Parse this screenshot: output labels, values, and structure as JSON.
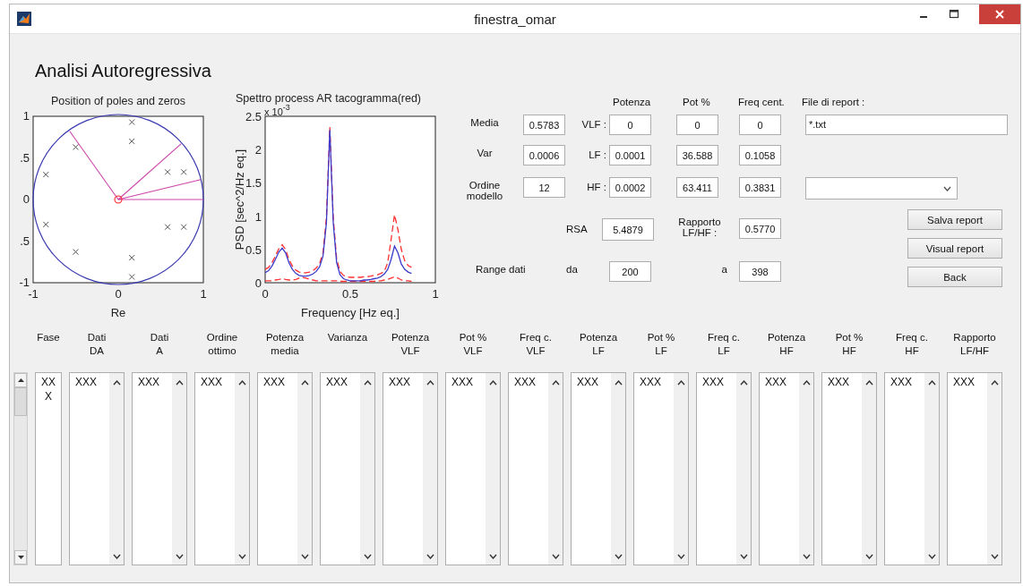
{
  "window": {
    "title": "finestra_omar"
  },
  "heading": "Analisi Autoregressiva",
  "pole_zero_plot": {
    "title": "Position of poles and zeros",
    "chart_data": {
      "type": "scatter",
      "xlabel": "Re",
      "xlim": [
        -1,
        1
      ],
      "ylim": [
        -1,
        1
      ],
      "xticks": [
        -1,
        0,
        1
      ],
      "yticks": [
        {
          "value": 1,
          "label": "1"
        },
        {
          "value": 0.5,
          "label": ".5"
        },
        {
          "value": 0,
          "label": "0"
        },
        {
          "value": -0.5,
          "label": ".5"
        },
        {
          "value": -1,
          "label": "-1"
        }
      ],
      "x": [
        0.16,
        0.16,
        -0.5,
        -0.85,
        0.58,
        0.77,
        0.58,
        0.77,
        -0.85,
        -0.5,
        0.16,
        0.16
      ],
      "series": [
        {
          "color": "#555555",
          "values": [
            0.93,
            0.7,
            0.63,
            0.3,
            0.33,
            0.33,
            -0.33,
            -0.33,
            -0.3,
            -0.63,
            -0.7,
            -0.93
          ]
        }
      ]
    }
  },
  "spectrum_plot": {
    "title": "Spettro process AR tacogramma(red)",
    "exponent": {
      "base": "x 10",
      "power": "-3"
    },
    "chart_data": {
      "type": "line",
      "xlabel": "Frequency [Hz eq.]",
      "ylabel": "PSD [sec^2/Hz eq.]",
      "xlim": [
        0,
        1
      ],
      "ylim": [
        0,
        2.5
      ],
      "xticks": [
        0,
        0.5,
        1
      ],
      "yticks": [
        0,
        0.5,
        1,
        1.5,
        2,
        2.5
      ],
      "x": [
        0,
        0.02,
        0.04,
        0.06,
        0.08,
        0.1,
        0.12,
        0.14,
        0.16,
        0.18,
        0.2,
        0.22,
        0.24,
        0.26,
        0.28,
        0.3,
        0.32,
        0.34,
        0.36,
        0.38,
        0.4,
        0.42,
        0.44,
        0.46,
        0.48,
        0.5,
        0.52,
        0.54,
        0.56,
        0.58,
        0.6,
        0.62,
        0.64,
        0.66,
        0.68,
        0.7,
        0.72,
        0.74,
        0.76,
        0.78,
        0.8,
        0.82,
        0.84,
        0.86
      ],
      "series": [
        {
          "color": "#ff3030",
          "line_style": "dashed",
          "values": [
            0.2,
            0.23,
            0.3,
            0.4,
            0.51,
            0.57,
            0.5,
            0.35,
            0.25,
            0.19,
            0.16,
            0.15,
            0.15,
            0.16,
            0.18,
            0.22,
            0.29,
            0.45,
            0.98,
            2.34,
            0.98,
            0.36,
            0.17,
            0.11,
            0.09,
            0.08,
            0.08,
            0.08,
            0.08,
            0.09,
            0.09,
            0.1,
            0.11,
            0.12,
            0.14,
            0.17,
            0.3,
            0.65,
            1.02,
            0.8,
            0.5,
            0.33,
            0.26,
            0.23
          ]
        },
        {
          "color": "#ff3030",
          "line_style": "dashed",
          "values": [
            0.03,
            0.03,
            0.03,
            0.04,
            0.05,
            0.06,
            0.05,
            0.04,
            0.04,
            0.05,
            0.07,
            0.08,
            0.07,
            0.05,
            0.04,
            0.03,
            0.03,
            0.03,
            0.03,
            0.03,
            0.03,
            0.03,
            0.02,
            0.02,
            0.02,
            0.02,
            0.02,
            0.02,
            0.02,
            0.02,
            0.02,
            0.02,
            0.02,
            0.03,
            0.03,
            0.04,
            0.05,
            0.07,
            0.09,
            0.07,
            0.04,
            0.03,
            0.03,
            0.02
          ]
        },
        {
          "color": "#3a3acc",
          "line_style": "solid",
          "values": [
            0.15,
            0.18,
            0.25,
            0.35,
            0.46,
            0.52,
            0.45,
            0.3,
            0.2,
            0.14,
            0.11,
            0.1,
            0.1,
            0.11,
            0.13,
            0.17,
            0.24,
            0.4,
            0.9,
            2.3,
            0.9,
            0.3,
            0.12,
            0.06,
            0.04,
            0.03,
            0.03,
            0.03,
            0.03,
            0.04,
            0.04,
            0.05,
            0.06,
            0.07,
            0.09,
            0.13,
            0.2,
            0.35,
            0.55,
            0.45,
            0.28,
            0.2,
            0.16,
            0.14
          ]
        }
      ]
    }
  },
  "parameters": {
    "headers": [
      "Potenza",
      "Pot %",
      "Freq cent."
    ],
    "rows": [
      {
        "label": "Media",
        "value": "0.5783",
        "band": "VLF :",
        "potenza": "0",
        "pot_pct": "0",
        "freq_cent": "0"
      },
      {
        "label": "Var",
        "value": "0.0006",
        "band": "LF :",
        "potenza": "0.0001",
        "pot_pct": "36.588",
        "freq_cent": "0.1058"
      },
      {
        "label": "Ordine modello",
        "value": "12",
        "band": "HF :",
        "potenza": "0.0002",
        "pot_pct": "63.411",
        "freq_cent": "0.3831"
      }
    ]
  },
  "report": {
    "label": "File di report :",
    "file_field": "*.txt"
  },
  "rsa": {
    "label": "RSA",
    "value": "5.4879"
  },
  "ratio": {
    "label": "Rapporto LF/HF :",
    "value": "0.5770"
  },
  "range": {
    "label": "Range dati",
    "from_label": "da",
    "from": "200",
    "to_label": "a",
    "to": "398"
  },
  "buttons": [
    "Salva report",
    "Visual report",
    "Back"
  ],
  "results_table": {
    "columns": [
      {
        "header": "Fase",
        "kind": "plain",
        "items": [
          "XXX"
        ]
      },
      {
        "header": "Dati\nDA",
        "kind": "list",
        "items": [
          "XXX"
        ]
      },
      {
        "header": "Dati\nA",
        "kind": "list",
        "items": [
          "XXX"
        ]
      },
      {
        "header": "Ordine\nottimo",
        "kind": "list",
        "items": [
          "XXX"
        ]
      },
      {
        "header": "Potenza\nmedia",
        "kind": "list",
        "items": [
          "XXX"
        ]
      },
      {
        "header": "Varianza",
        "kind": "list",
        "items": [
          "XXX"
        ]
      },
      {
        "header": "Potenza\nVLF",
        "kind": "list",
        "items": [
          "XXX"
        ]
      },
      {
        "header": "Pot %\nVLF",
        "kind": "list",
        "items": [
          "XXX"
        ]
      },
      {
        "header": "Freq c.\nVLF",
        "kind": "list",
        "items": [
          "XXX"
        ]
      },
      {
        "header": "Potenza\nLF",
        "kind": "list",
        "items": [
          "XXX"
        ]
      },
      {
        "header": "Pot %\nLF",
        "kind": "list",
        "items": [
          "XXX"
        ]
      },
      {
        "header": "Freq c.\nLF",
        "kind": "list",
        "items": [
          "XXX"
        ]
      },
      {
        "header": "Potenza\nHF",
        "kind": "list",
        "items": [
          "XXX"
        ]
      },
      {
        "header": "Pot %\nHF",
        "kind": "list",
        "items": [
          "XXX"
        ]
      },
      {
        "header": "Freq c.\nHF",
        "kind": "list",
        "items": [
          "XXX"
        ]
      },
      {
        "header": "Rapporto\nLF/HF",
        "kind": "list",
        "items": [
          "XXX"
        ]
      }
    ]
  }
}
